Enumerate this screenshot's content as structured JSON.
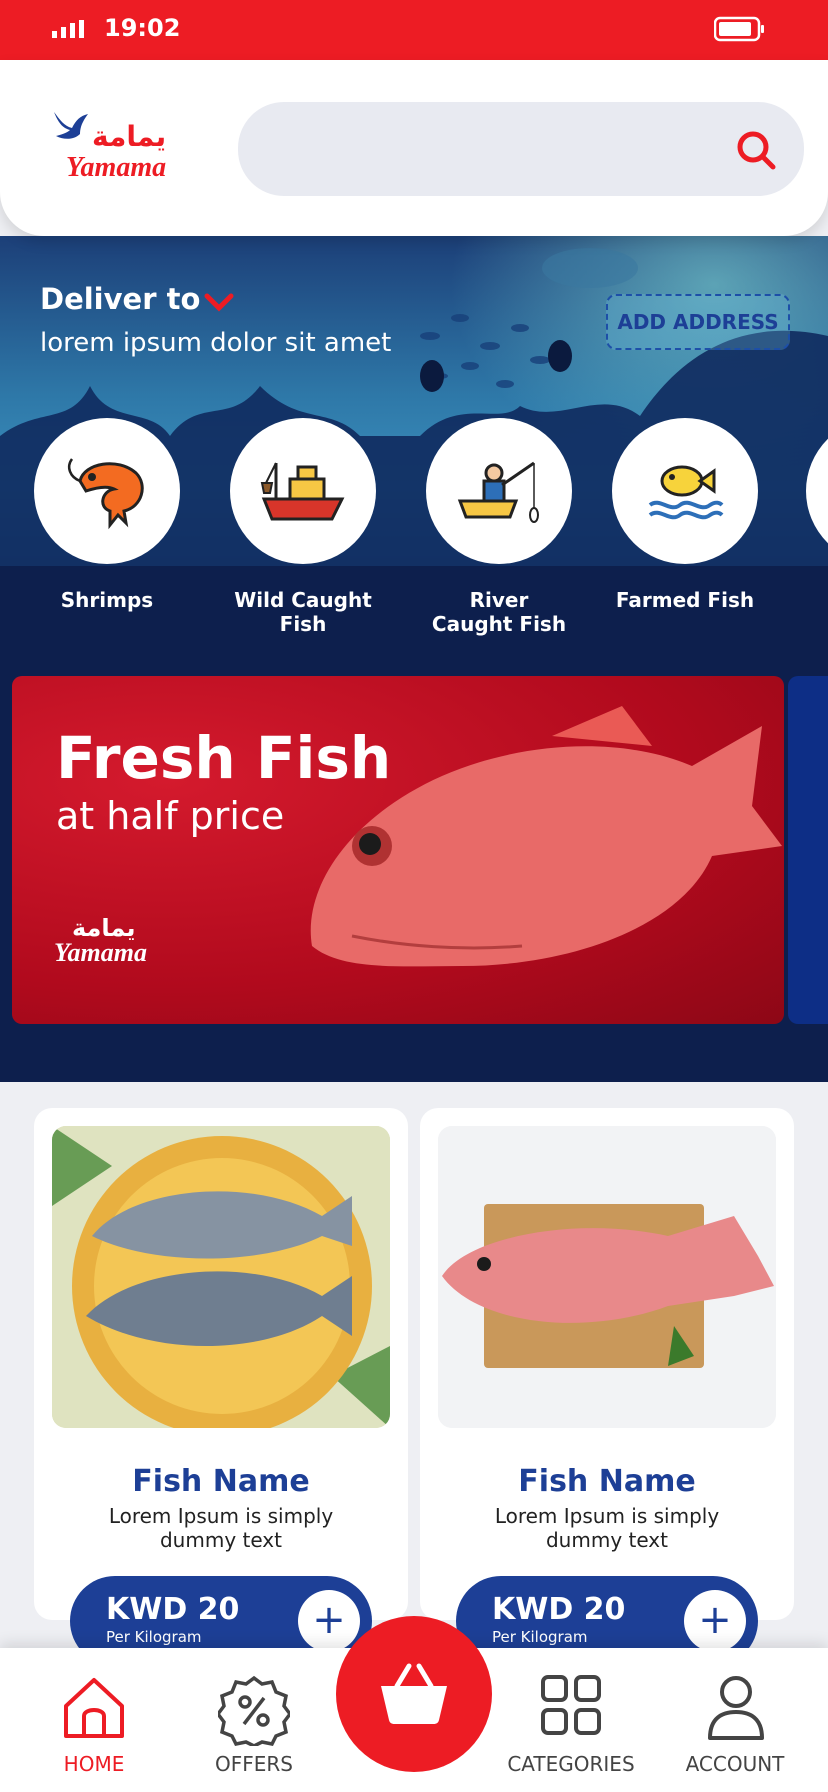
{
  "status_bar": {
    "time": "19:02"
  },
  "header": {
    "logo_arabic": "يمامة",
    "logo_english": "Yamama",
    "search": {
      "placeholder": "",
      "value": ""
    }
  },
  "delivery": {
    "label": "Deliver to",
    "address": "lorem ipsum dolor sit amet",
    "add_address_label": "ADD ADDRESS"
  },
  "categories": [
    {
      "label": "Shrimps",
      "icon": "shrimp-icon"
    },
    {
      "label": "Wild Caught Fish",
      "icon": "fishing-boat-icon"
    },
    {
      "label": "River Caught Fish",
      "icon": "fisherman-icon"
    },
    {
      "label": "Farmed Fish",
      "icon": "farmed-fish-icon"
    }
  ],
  "banner": {
    "title": "Fresh Fish",
    "subtitle": "at half price",
    "logo_arabic": "يمامة",
    "logo_english": "Yamama"
  },
  "products": [
    {
      "name": "Fish Name",
      "description": "Lorem Ipsum is simply dummy text",
      "price": "KWD 20",
      "unit": "Per Kilogram"
    },
    {
      "name": "Fish Name",
      "description": "Lorem Ipsum is simply dummy text",
      "price": "KWD 20",
      "unit": "Per Kilogram"
    }
  ],
  "tabbar": {
    "home": "HOME",
    "offers": "OFFERS",
    "categories": "CATEGORIES",
    "account": "ACCOUNT",
    "active": "home"
  },
  "colors": {
    "brand_red": "#ed1c24",
    "brand_blue": "#1d3f96",
    "navy": "#0d1f4d"
  }
}
